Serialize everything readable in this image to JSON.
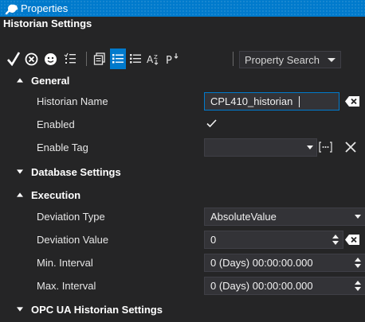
{
  "window": {
    "title": "Properties"
  },
  "header": {
    "section_title": "Historian Settings"
  },
  "toolbar": {
    "buttons": [
      {
        "name": "apply-icon"
      },
      {
        "name": "cancel-circle-icon"
      },
      {
        "name": "smiley-icon"
      },
      {
        "name": "checklist-icon"
      },
      {
        "name": "property-pages-icon"
      },
      {
        "name": "categorized-view-icon",
        "active": true
      },
      {
        "name": "categorized-list-icon"
      },
      {
        "name": "alphabetical-sort-icon"
      },
      {
        "name": "property-filter-icon"
      }
    ],
    "search_label": "Property Search"
  },
  "grid": {
    "general": {
      "label": "General",
      "historian_name": {
        "label": "Historian Name",
        "value": "CPL410_historian"
      },
      "enabled": {
        "label": "Enabled",
        "checked": true
      },
      "enable_tag": {
        "label": "Enable Tag",
        "value": ""
      }
    },
    "database_settings": {
      "label": "Database Settings"
    },
    "execution": {
      "label": "Execution",
      "deviation_type": {
        "label": "Deviation Type",
        "value": "AbsoluteValue"
      },
      "deviation_value": {
        "label": "Deviation Value",
        "value": "0"
      },
      "min_interval": {
        "label": "Min. Interval",
        "value": "0 (Days) 00:00:00.000"
      },
      "max_interval": {
        "label": "Max. Interval",
        "value": "0 (Days) 00:00:00.000"
      }
    },
    "opc_ua": {
      "label": "OPC UA Historian Settings"
    }
  },
  "colors": {
    "accent": "#007acc",
    "background": "#252526",
    "field": "#333337"
  }
}
